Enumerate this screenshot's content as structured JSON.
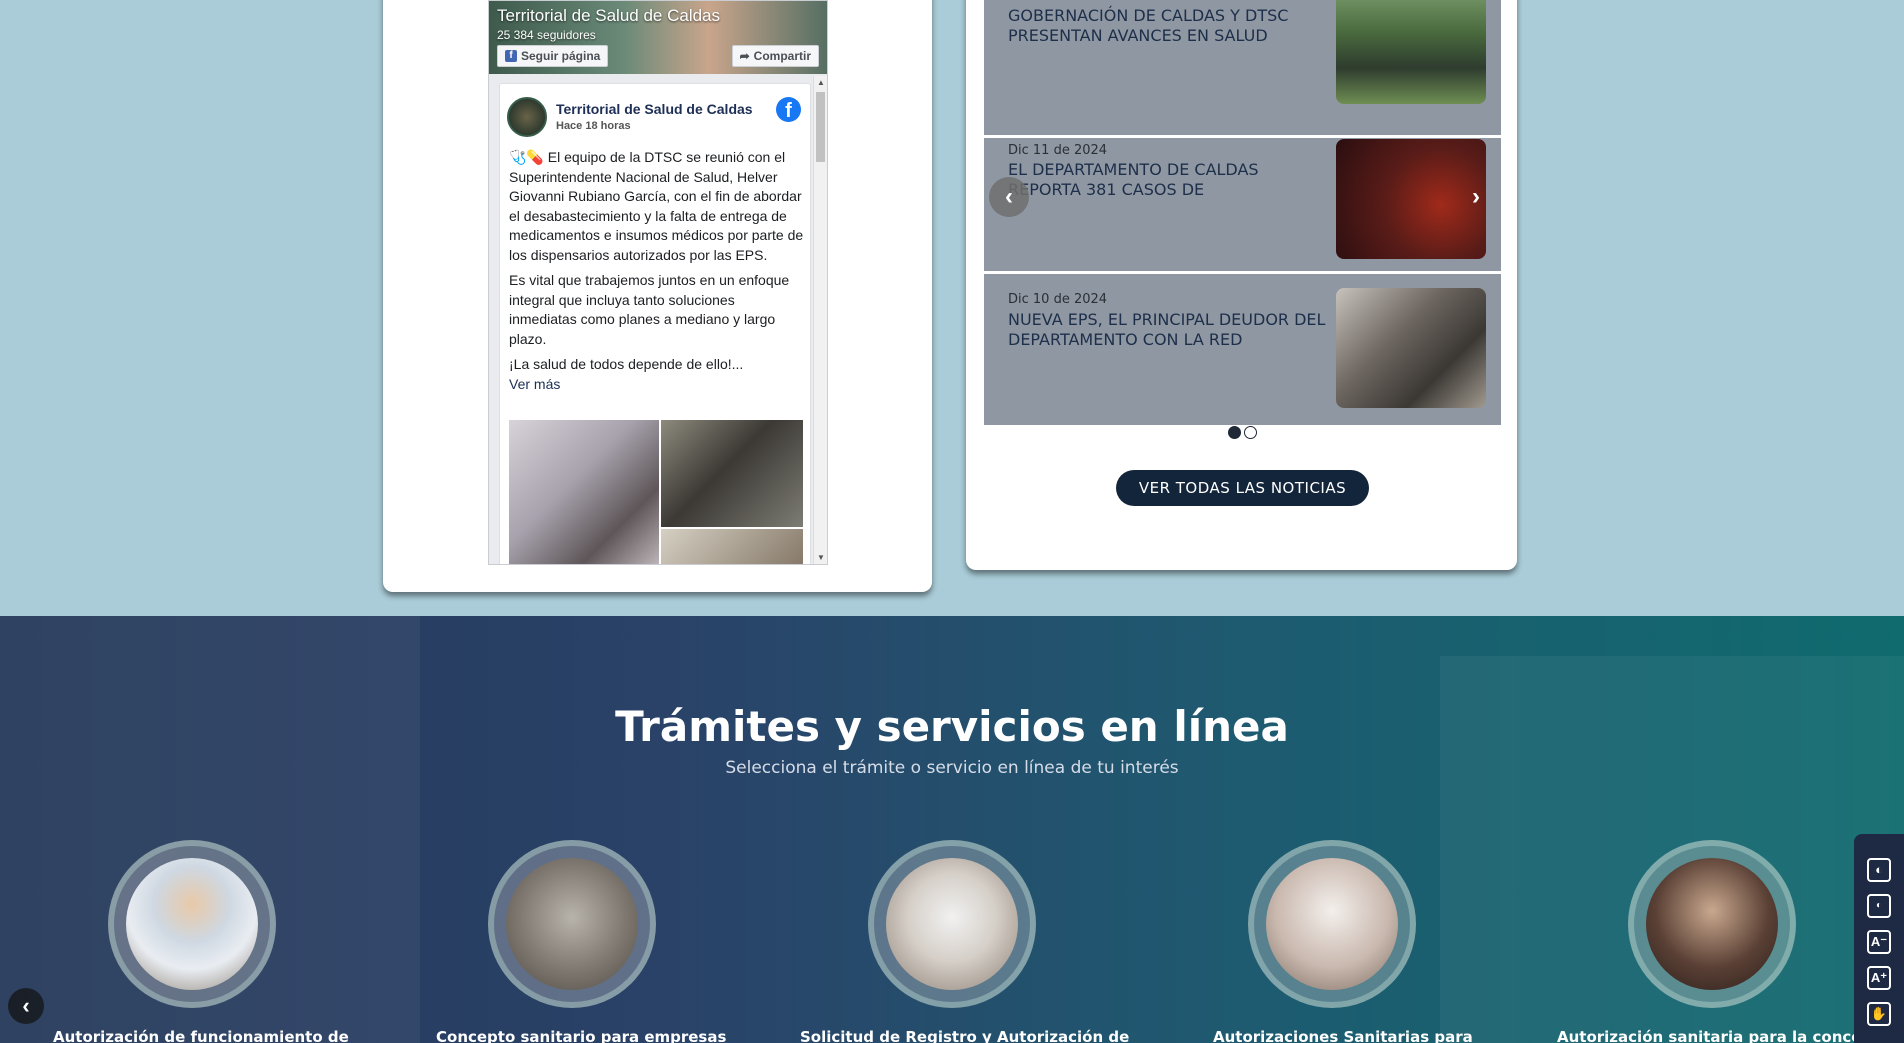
{
  "facebook": {
    "page_title": "Territorial de Salud de Caldas",
    "followers": "25 384 seguidores",
    "follow_label": "Seguir página",
    "share_label": "Compartir",
    "post": {
      "author": "Territorial de Salud de Caldas",
      "time": "Hace 18 horas",
      "paragraph1": "🩺💊 El equipo de la DTSC se reunió con el Superintendente Nacional de Salud, Helver Giovanni Rubiano García, con el fin de abordar el desabastecimiento y la falta de entrega de medicamentos e insumos médicos por parte de los dispensarios autorizados por las EPS.",
      "paragraph2": "Es vital que trabajemos juntos en un enfoque integral que incluya tanto soluciones inmediatas como planes a mediano y largo plazo.",
      "paragraph3": "¡La salud de todos depende de ello!...",
      "see_more": "Ver más"
    }
  },
  "news": {
    "items": [
      {
        "date": "",
        "title": "GOBERNACIÓN DE CALDAS Y DTSC PRESENTAN AVANCES EN SALUD"
      },
      {
        "date": "Dic 11 de 2024",
        "title": "EL DEPARTAMENTO DE CALDAS REPORTA 381 CASOS DE"
      },
      {
        "date": "Dic 10 de 2024",
        "title": "NUEVA EPS, EL PRINCIPAL DEUDOR DEL DEPARTAMENTO CON LA RED"
      }
    ],
    "prev_icon": "chevron-left-icon",
    "next_icon": "chevron-right-icon",
    "all_news_label": "VER TODAS LAS NOTICIAS"
  },
  "tramites": {
    "title": "Trámites y servicios en línea",
    "subtitle": "Selecciona el trámite o servicio en línea de tu interés",
    "items": [
      {
        "label": "Autorización de funcionamiento de"
      },
      {
        "label": "Concepto sanitario para empresas"
      },
      {
        "label": "Solicitud de Registro y Autorización de"
      },
      {
        "label": "Autorizaciones Sanitarias para"
      },
      {
        "label": "Autorización sanitaria para la concesi"
      }
    ]
  },
  "accessibility": {
    "buttons": [
      "contrast-icon",
      "invert-contrast-icon",
      "decrease-font-icon",
      "increase-font-icon",
      "sign-language-icon"
    ]
  },
  "colors": {
    "page_bg": "#a9ccd8",
    "button_dark": "#13253b",
    "news_panel": "#8f97a2"
  }
}
